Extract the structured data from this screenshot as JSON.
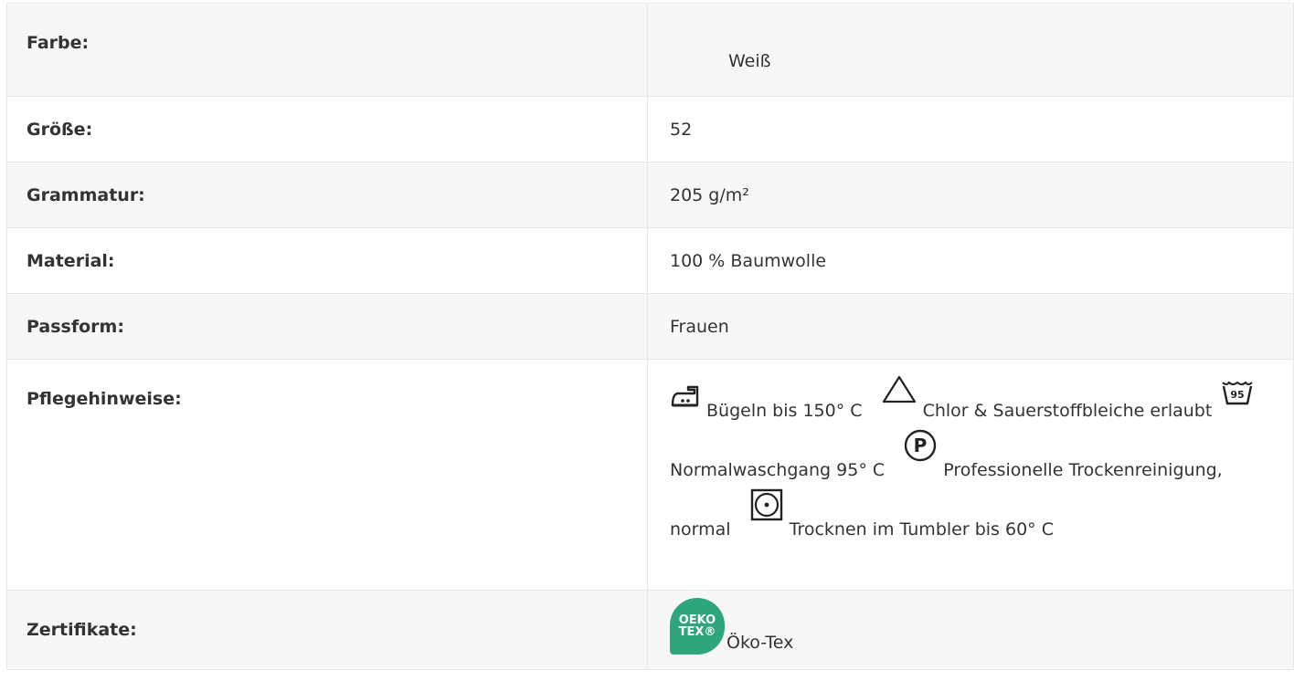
{
  "specs": {
    "farbe": {
      "label": "Farbe:",
      "value": "Weiß"
    },
    "groesse": {
      "label": "Größe:",
      "value": "52"
    },
    "grammatur": {
      "label": "Grammatur:",
      "value": "205 g/m²"
    },
    "material": {
      "label": "Material:",
      "value": "100 % Baumwolle"
    },
    "passform": {
      "label": "Passform:",
      "value": "Frauen"
    },
    "pflege": {
      "label": "Pflegehinweise:",
      "items": [
        {
          "icon": "iron-icon",
          "text": "Bügeln bis 150° C"
        },
        {
          "icon": "bleach-triangle-icon",
          "text": "Chlor & Sauerstoffbleiche erlaubt"
        },
        {
          "icon": "wash-tub-95-icon",
          "icon_text": "95",
          "text": "Normalwaschgang 95° C"
        },
        {
          "icon": "dry-clean-p-icon",
          "icon_text": "P",
          "text": "Professionelle Trockenreinigung, normal"
        },
        {
          "icon": "tumble-dry-icon",
          "text": "Trocknen im Tumbler bis 60° C"
        }
      ]
    },
    "zertifikate": {
      "label": "Zertifikate:",
      "badge_line1": "OEKO",
      "badge_line2": "TEX®",
      "value": "Öko-Tex"
    }
  },
  "colors": {
    "row_shaded": "#f7f7f7",
    "row_plain": "#ffffff",
    "border": "#e8e8e8",
    "text": "#333333",
    "oeko_green": "#2ea57b"
  }
}
